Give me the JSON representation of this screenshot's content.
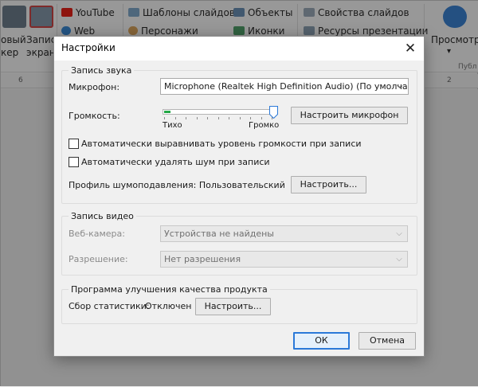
{
  "ribbon": {
    "btn_record_video_cut": "овый",
    "btn_record_video_cut2": "кер",
    "btn_record_screen_cut": "Запис",
    "btn_record_screen_cut2": "экран",
    "youtube": "YouTube",
    "web": "Web",
    "slide_templates": "Шаблоны слайдов",
    "characters": "Персонажи",
    "objects": "Объекты",
    "icons": "Иконки",
    "slide_properties": "Свойства слайдов",
    "presentation_resources": "Ресурсы презентации",
    "preview": "Просмотр",
    "preview_arrow": "▾",
    "group_publish_cut": "Публ"
  },
  "ruler": {
    "mark_left": "6",
    "mark_right": "2"
  },
  "dialog": {
    "title": "Настройки",
    "close_glyph": "✕",
    "audio": {
      "legend": "Запись звука",
      "mic_label": "Микрофон:",
      "mic_value": "Microphone (Realtek High Definition Audio) (По умолчанию)",
      "volume_label": "Громкость:",
      "volume_low": "Тихо",
      "volume_high": "Громко",
      "volume_level": 1.0,
      "input_level": 0.06,
      "setup_mic_button": "Настроить микрофон",
      "auto_level_label": "Автоматически выравнивать уровень громкости при записи",
      "auto_level_checked": false,
      "auto_noise_label": "Автоматически удалять шум при записи",
      "auto_noise_checked": false,
      "noise_profile_label": "Профиль шумоподавления: Пользовательский",
      "noise_setup_button": "Настроить..."
    },
    "video": {
      "legend": "Запись видео",
      "webcam_label": "Веб-камера:",
      "webcam_value": "Устройства не найдены",
      "resolution_label": "Разрешение:",
      "resolution_value": "Нет разрешения"
    },
    "improve": {
      "legend": "Программа улучшения качества продукта",
      "stats_label": "Сбор статистики:",
      "stats_value": "Отключен",
      "setup_button": "Настроить..."
    },
    "ok_button": "ОК",
    "cancel_button": "Отмена",
    "chevron_glyph": "⌵"
  },
  "colors": {
    "accent": "#2b79d8",
    "level_green": "#23a847",
    "youtube_red": "#e62117"
  }
}
